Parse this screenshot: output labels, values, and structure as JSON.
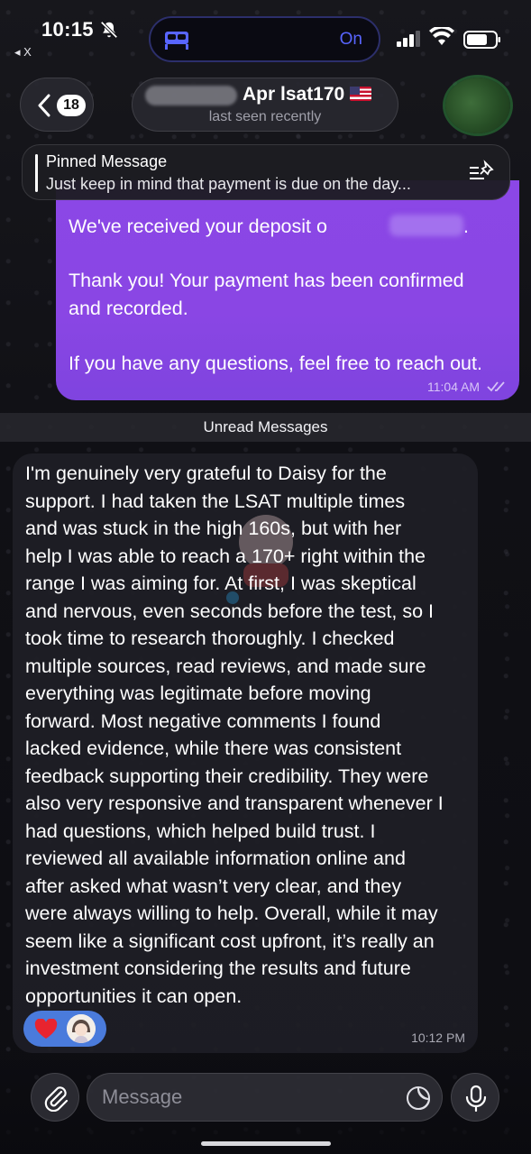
{
  "status_bar": {
    "time": "10:15",
    "back_app": "◂ X",
    "focus_mode_status": "On",
    "icons": [
      "bell-slash-icon",
      "bed-icon",
      "cellular-signal-icon",
      "wifi-icon",
      "battery-icon"
    ]
  },
  "header": {
    "unread_count": "18",
    "chat_name": "Apr lsat170",
    "last_seen": "last seen recently"
  },
  "pinned": {
    "title": "Pinned Message",
    "text": "Just keep in mind that payment is due on the day..."
  },
  "outgoing_message": {
    "lines": [
      "We've received your deposit o",
      "",
      "Thank you! Your payment has been confirmed",
      "and recorded.",
      "",
      "If you have any questions, feel free to reach out."
    ],
    "deposit_suffix": ".",
    "time": "11:04 AM",
    "status": "read"
  },
  "divider": {
    "label": "Unread Messages"
  },
  "incoming_message": {
    "lines": [
      "I'm genuinely very grateful to Daisy for the",
      "support. I had taken the LSAT multiple times",
      "and was stuck in the high 160s, but with her",
      "help I was able to reach a 170+ right within the",
      "range I was aiming for. At first, I was skeptical",
      "and nervous, even seconds before the test, so I",
      "took time to research thoroughly. I checked",
      "multiple sources, read reviews, and made sure",
      "everything was legitimate before moving",
      "forward. Most negative comments I found",
      "lacked evidence, while there was consistent",
      "feedback supporting their credibility. They were",
      "also very responsive and transparent whenever I",
      "had questions, which helped build trust. I",
      "reviewed all available information online and",
      "after asked what wasn’t very clear, and they",
      "were always willing to help. Overall, while it may",
      "seem like a significant cost upfront, it’s really an",
      "investment considering the results and future",
      "opportunities it can open."
    ],
    "time": "10:12 PM",
    "reactions": [
      "heart-icon",
      "avatar"
    ]
  },
  "composer": {
    "placeholder": "Message"
  },
  "colors": {
    "outgoing_bubble": "#8b47e6",
    "incoming_bubble": "#1e1e26",
    "reaction_pill": "#4a7bdc",
    "island_accent": "#5865ff"
  }
}
